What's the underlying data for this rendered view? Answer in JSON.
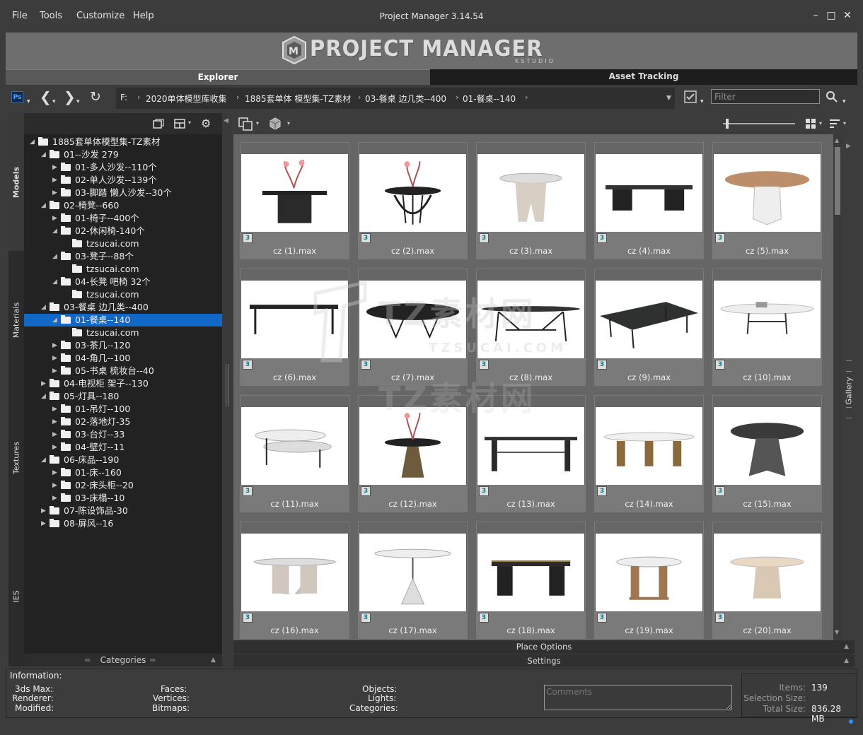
{
  "window": {
    "title": "Project Manager 3.14.54"
  },
  "menu": [
    "File",
    "Tools",
    "Customize",
    "Help"
  ],
  "window_controls": [
    "minimize-icon",
    "maximize-icon",
    "close-icon"
  ],
  "banner": {
    "logo_text": "PROJECT MANAGER",
    "logo_sub": "KSTUDIO"
  },
  "tabs": {
    "explorer": "Explorer",
    "asset": "Asset Tracking"
  },
  "nav": {
    "ps_label": "Ps",
    "breadcrumb": [
      "F:",
      "2020单体模型库收集",
      "1885套单体 模型集-TZ素材",
      "03-餐桌 边几类--400",
      "01-餐桌--140"
    ],
    "filter_placeholder": "Filter"
  },
  "side_tabs": [
    "Models",
    "Materials",
    "Textures",
    "IES"
  ],
  "right_tab": "Gallery",
  "tree": [
    {
      "label": "1885套单体模型集-TZ素材",
      "level": 0,
      "arrow": "open"
    },
    {
      "label": "01--沙发 279",
      "level": 1,
      "arrow": "open"
    },
    {
      "label": "01-多人沙发--110个",
      "level": 2,
      "arrow": "closed"
    },
    {
      "label": "02-单人沙发--139个",
      "level": 2,
      "arrow": "closed"
    },
    {
      "label": "03-脚踏 懒人沙发--30个",
      "level": 2,
      "arrow": "closed"
    },
    {
      "label": "02-椅凳--660",
      "level": 1,
      "arrow": "open"
    },
    {
      "label": "01-椅子--400个",
      "level": 2,
      "arrow": "closed"
    },
    {
      "label": "02-休闲椅-140个",
      "level": 2,
      "arrow": "open"
    },
    {
      "label": "tzsucai.com",
      "level": 3,
      "arrow": "none"
    },
    {
      "label": "03-凳子--88个",
      "level": 2,
      "arrow": "open"
    },
    {
      "label": "tzsucai.com",
      "level": 3,
      "arrow": "none"
    },
    {
      "label": "04-长凳 吧椅 32个",
      "level": 2,
      "arrow": "open"
    },
    {
      "label": "tzsucai.com",
      "level": 3,
      "arrow": "none"
    },
    {
      "label": "03-餐桌 边几类--400",
      "level": 1,
      "arrow": "open"
    },
    {
      "label": "01-餐桌--140",
      "level": 2,
      "arrow": "open",
      "selected": true
    },
    {
      "label": "tzsucai.com",
      "level": 3,
      "arrow": "none"
    },
    {
      "label": "03-茶几--120",
      "level": 2,
      "arrow": "closed"
    },
    {
      "label": "04-角几--100",
      "level": 2,
      "arrow": "closed"
    },
    {
      "label": "05-书桌 梳妆台--40",
      "level": 2,
      "arrow": "closed"
    },
    {
      "label": "04-电视柜 架子--130",
      "level": 1,
      "arrow": "closed"
    },
    {
      "label": "05-灯具--180",
      "level": 1,
      "arrow": "open"
    },
    {
      "label": "01-吊灯--100",
      "level": 2,
      "arrow": "closed"
    },
    {
      "label": "02-落地灯-35",
      "level": 2,
      "arrow": "closed"
    },
    {
      "label": "03-台灯--33",
      "level": 2,
      "arrow": "closed"
    },
    {
      "label": "04-壁灯--11",
      "level": 2,
      "arrow": "closed"
    },
    {
      "label": "06-床品--190",
      "level": 1,
      "arrow": "open"
    },
    {
      "label": "01-床--160",
      "level": 2,
      "arrow": "closed"
    },
    {
      "label": "02-床头柜--20",
      "level": 2,
      "arrow": "closed"
    },
    {
      "label": "03-床榻--10",
      "level": 2,
      "arrow": "closed"
    },
    {
      "label": "07-陈设饰品-30",
      "level": 1,
      "arrow": "closed"
    },
    {
      "label": "08-屏风--16",
      "level": 1,
      "arrow": "closed"
    }
  ],
  "categories_label": "Categories",
  "gallery": {
    "badge": "3",
    "items": [
      "cz (1).max",
      "cz (2).max",
      "cz (3).max",
      "cz (4).max",
      "cz (5).max",
      "cz (6).max",
      "cz (7).max",
      "cz (8).max",
      "cz (9).max",
      "cz (10).max",
      "cz (11).max",
      "cz (12).max",
      "cz (13).max",
      "cz (14).max",
      "cz (15).max",
      "cz (16).max",
      "cz (17).max",
      "cz (18).max",
      "cz (19).max",
      "cz (20).max"
    ]
  },
  "watermark": {
    "cn": "TZ素材网",
    "en": "TZSUCAI.COM"
  },
  "place_options": "Place Options",
  "settings": "Settings",
  "info": {
    "title": "Information:",
    "left": [
      "3ds Max:",
      "Renderer:",
      "Modified:"
    ],
    "mid": [
      "Faces:",
      "Vertices:",
      "Bitmaps:"
    ],
    "right": [
      "Objects:",
      "Lights:",
      "Categories:"
    ],
    "comments_placeholder": "Comments"
  },
  "stats": {
    "items_label": "Items:",
    "items_value": "139",
    "selection_label": "Selection Size:",
    "selection_value": "",
    "total_label": "Total Size:",
    "total_value": "836.28 MB"
  }
}
